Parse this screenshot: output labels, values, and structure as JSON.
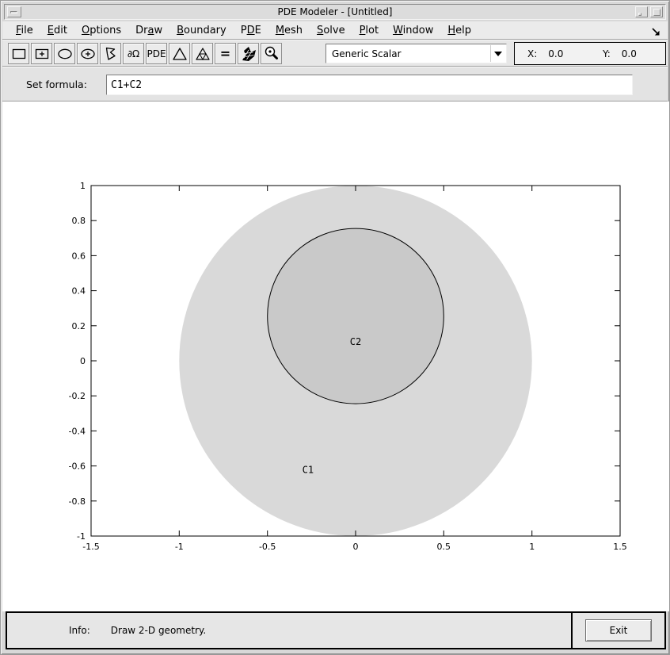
{
  "window": {
    "title": "PDE Modeler - [Untitled]"
  },
  "menu": {
    "items": [
      {
        "label": "File",
        "mnemonic": 0
      },
      {
        "label": "Edit",
        "mnemonic": 0
      },
      {
        "label": "Options",
        "mnemonic": 0
      },
      {
        "label": "Draw",
        "mnemonic": 2
      },
      {
        "label": "Boundary",
        "mnemonic": 0
      },
      {
        "label": "PDE",
        "mnemonic": 1
      },
      {
        "label": "Mesh",
        "mnemonic": 0
      },
      {
        "label": "Solve",
        "mnemonic": 0
      },
      {
        "label": "Plot",
        "mnemonic": 0
      },
      {
        "label": "Window",
        "mnemonic": 0
      },
      {
        "label": "Help",
        "mnemonic": 0
      }
    ]
  },
  "toolbar": {
    "buttons": [
      {
        "name": "draw-rectangle",
        "icon": "rect"
      },
      {
        "name": "draw-rectangle-center",
        "icon": "rect-plus"
      },
      {
        "name": "draw-ellipse",
        "icon": "ellipse"
      },
      {
        "name": "draw-ellipse-center",
        "icon": "ellipse-plus"
      },
      {
        "name": "draw-polygon",
        "icon": "polygon"
      },
      {
        "name": "boundary-mode",
        "icon": "text",
        "text": "∂Ω"
      },
      {
        "name": "pde-mode",
        "icon": "text",
        "text": "PDE"
      },
      {
        "name": "mesh-mode",
        "icon": "triangle"
      },
      {
        "name": "refine-mesh",
        "icon": "triangle-refined"
      },
      {
        "name": "solve-pde",
        "icon": "text-eq",
        "text": "="
      },
      {
        "name": "plot-solution",
        "icon": "mesh-plot"
      },
      {
        "name": "zoom",
        "icon": "magnifier"
      }
    ],
    "application_dropdown": {
      "value": "Generic Scalar"
    },
    "coords": {
      "x_label": "X:",
      "x_value": "0.0",
      "y_label": "Y:",
      "y_value": "0.0"
    }
  },
  "formula": {
    "label": "Set formula:",
    "value": "C1+C2"
  },
  "plot": {
    "xlim": [
      -1.5,
      1.5
    ],
    "ylim": [
      -1,
      1
    ],
    "x_ticks": [
      "-1.5",
      "-1",
      "-0.5",
      "0",
      "0.5",
      "1",
      "1.5"
    ],
    "y_ticks": [
      "1",
      "0.8",
      "0.6",
      "0.4",
      "0.2",
      "0",
      "-0.2",
      "-0.4",
      "-0.6",
      "-0.8",
      "-1"
    ],
    "regions": [
      {
        "label": "C1",
        "center": [
          0,
          0
        ],
        "radius": 1,
        "fill": "#d9d9d9",
        "stroke": "none",
        "label_pos": [
          -0.27,
          -0.64
        ]
      },
      {
        "label": "C2",
        "center": [
          0,
          0.255
        ],
        "radius": 0.5,
        "fill": "#c9c9c9",
        "stroke": "#000000",
        "label_pos": [
          0,
          0.09
        ]
      }
    ]
  },
  "statusbar": {
    "info_label": "Info:",
    "info_text": "Draw 2-D geometry.",
    "exit_label": "Exit"
  }
}
